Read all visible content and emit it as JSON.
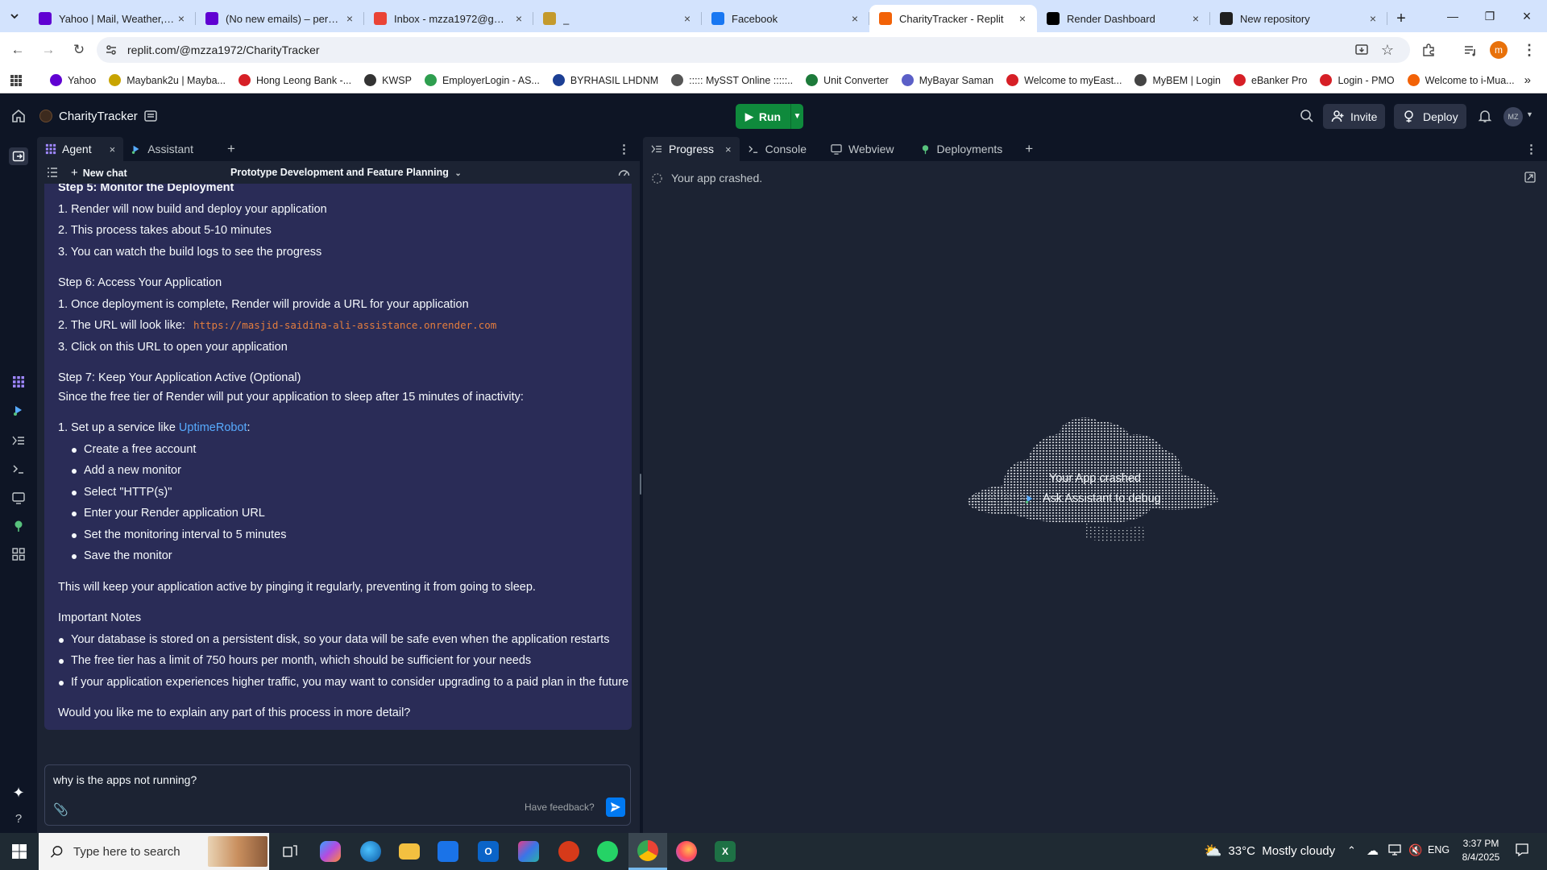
{
  "browser": {
    "tabs": [
      {
        "title": "Yahoo | Mail, Weather, Se",
        "icon": "yahoo-icon",
        "color": "#6001d2"
      },
      {
        "title": "(No new emails) – perund",
        "icon": "mail-icon",
        "color": "#6001d2"
      },
      {
        "title": "Inbox - mzza1972@gmail",
        "icon": "gmail-icon",
        "color": "#ea4335"
      },
      {
        "title": "_",
        "icon": "coin-icon",
        "color": "#c49a2c"
      },
      {
        "title": "Facebook",
        "icon": "facebook-icon",
        "color": "#1877f2"
      },
      {
        "title": "CharityTracker - Replit",
        "icon": "replit-icon",
        "color": "#f26207",
        "active": true
      },
      {
        "title": "Render Dashboard",
        "icon": "render-icon",
        "color": "#000000"
      },
      {
        "title": "New repository",
        "icon": "github-icon",
        "color": "#1f1f1f"
      }
    ],
    "url": "replit.com/@mzza1972/CharityTracker",
    "profile_initial": "m",
    "bookmarks": [
      {
        "label": "Yahoo",
        "color": "#6001d2"
      },
      {
        "label": "Maybank2u | Mayba...",
        "color": "#c8a400"
      },
      {
        "label": "Hong Leong Bank -...",
        "color": "#d61f26"
      },
      {
        "label": "KWSP",
        "color": "#333333"
      },
      {
        "label": "EmployerLogin - AS...",
        "color": "#2e9e4f"
      },
      {
        "label": "BYRHASIL LHDNM",
        "color": "#1c3f94"
      },
      {
        "label": "::::: MySST Online :::::..",
        "color": "#555555"
      },
      {
        "label": "Unit Converter",
        "color": "#1d7a3a"
      },
      {
        "label": "MyBayar Saman",
        "color": "#5b5fc7"
      },
      {
        "label": "Welcome to myEast...",
        "color": "#d61f26"
      },
      {
        "label": "MyBEM | Login",
        "color": "#444444"
      },
      {
        "label": "eBanker Pro",
        "color": "#d61f26"
      },
      {
        "label": "Login - PMO",
        "color": "#d61f26"
      },
      {
        "label": "Welcome to i-Mua...",
        "color": "#f26207"
      }
    ]
  },
  "replit": {
    "project_name": "CharityTracker",
    "run_label": "Run",
    "invite_label": "Invite",
    "deploy_label": "Deploy",
    "avatar_initials": "MZ",
    "accent_color": "#0f8a3c"
  },
  "agent_pane": {
    "tabs": [
      "Agent",
      "Assistant"
    ],
    "new_chat_label": "New chat",
    "chat_title": "Prototype Development and Feature Planning",
    "message": {
      "lines": [
        "Step 5: Monitor the Deployment",
        "1. Render will now build and deploy your application",
        "2. This process takes about 5-10 minutes",
        "3. You can watch the build logs to see the progress",
        "Step 6: Access Your Application",
        "1. Once deployment is complete, Render will provide a URL for your application",
        "2. The URL will look like:",
        "https://masjid-saidina-ali-assistance.onrender.com",
        "3. Click on this URL to open your application",
        "Step 7: Keep Your Application Active (Optional)",
        "Since the free tier of Render will put your application to sleep after 15 minutes of inactivity:",
        "1. Set up a service like",
        "UptimeRobot",
        ":",
        "This will keep your application active by pinging it regularly, preventing it from going to sleep.",
        "Important Notes",
        "Would you like me to explain any part of this process in more detail?"
      ],
      "uptimerobot_steps": [
        "Create a free account",
        "Add a new monitor",
        "Select \"HTTP(s)\"",
        "Enter your Render application URL",
        "Set the monitoring interval to 5 minutes",
        "Save the monitor"
      ],
      "notes": [
        "Your database is stored on a persistent disk, so your data will be safe even when the application restarts",
        "The free tier has a limit of 750 hours per month, which should be sufficient for your needs",
        "If your application experiences higher traffic, you may want to consider upgrading to a paid plan in the future"
      ]
    },
    "composer": {
      "value": "why is the apps not running?",
      "feedback_label": "Have feedback?"
    }
  },
  "right_pane": {
    "tabs": [
      "Progress",
      "Console",
      "Webview",
      "Deployments"
    ],
    "status_text": "Your app crashed.",
    "crash_title": "Your App crashed",
    "debug_label": "Ask Assistant to debug"
  },
  "taskbar": {
    "search_placeholder": "Type here to search",
    "weather": "33°C  Mostly cloudy",
    "language": "ENG",
    "time": "3:37 PM",
    "date": "8/4/2025"
  }
}
